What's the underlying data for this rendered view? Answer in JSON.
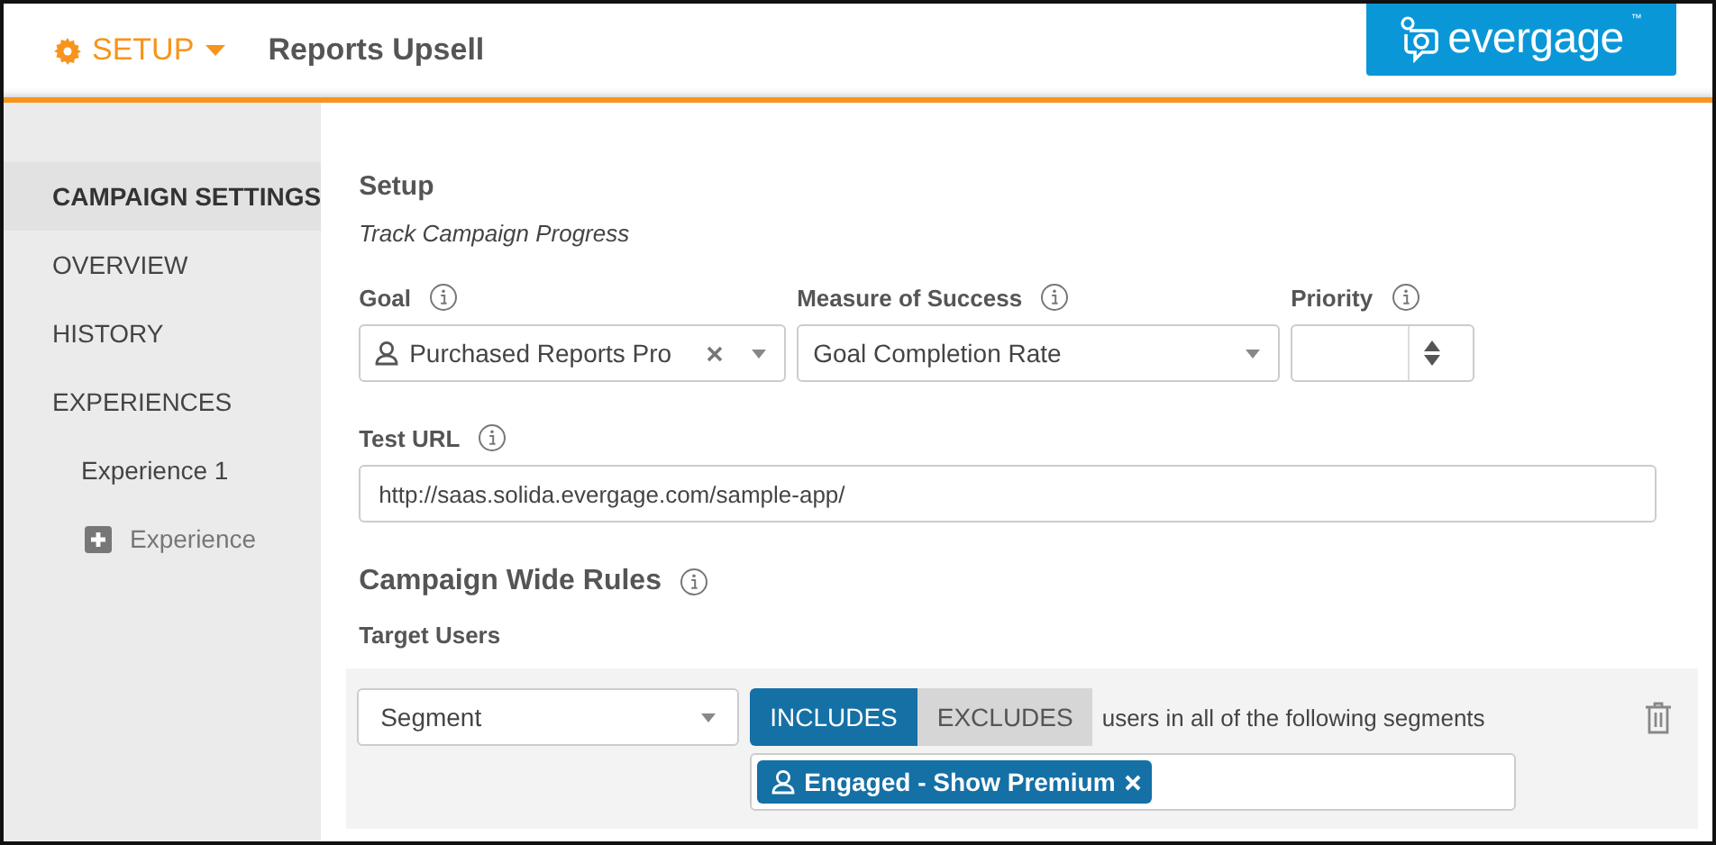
{
  "header": {
    "menu": "SETUP",
    "title": "Reports Upsell",
    "logo": {
      "text": "evergage",
      "mark": "™"
    }
  },
  "sidebar": {
    "items": [
      {
        "label": "CAMPAIGN SETTINGS",
        "selected": true
      },
      {
        "label": "OVERVIEW",
        "selected": false
      },
      {
        "label": "HISTORY",
        "selected": false
      },
      {
        "label": "EXPERIENCES",
        "selected": false,
        "children": [
          {
            "label": "Experience 1",
            "kind": "item",
            "selected": false
          },
          {
            "label": "Experience",
            "kind": "add",
            "selected": false
          }
        ]
      }
    ]
  },
  "setup": {
    "title": "Setup",
    "subtitle": "Track Campaign Progress",
    "goal": {
      "label": "Goal",
      "value": "Purchased Reports Pro"
    },
    "measure": {
      "label": "Measure of Success",
      "value": "Goal Completion Rate"
    },
    "priority": {
      "label": "Priority"
    },
    "test_url": {
      "label": "Test URL",
      "value": "http://saas.solida.evergage.com/sample-app/"
    }
  },
  "rules": {
    "title": "Campaign Wide Rules",
    "target_label": "Target Users",
    "select": "Segment",
    "toggle": [
      {
        "label": "INCLUDES",
        "selected": true
      },
      {
        "label": "EXCLUDES",
        "selected": false
      }
    ],
    "description": "users in all of the following segments",
    "tags": [
      "Engaged - Show Premium"
    ]
  }
}
